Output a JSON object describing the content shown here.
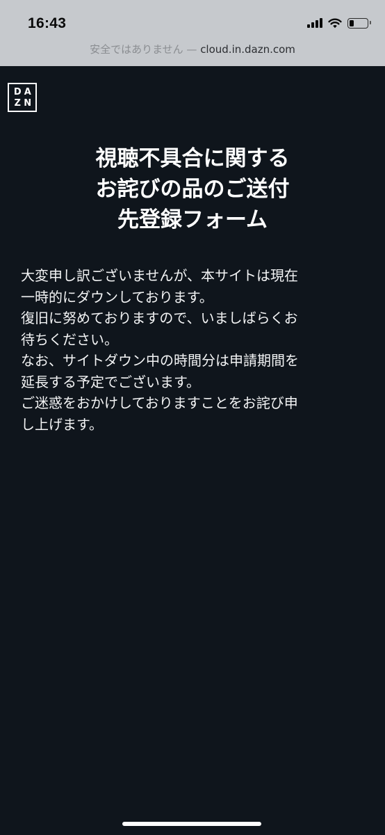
{
  "status_bar": {
    "time": "16:43"
  },
  "browser": {
    "security_warning": "安全ではありません",
    "separator": "—",
    "domain": "cloud.in.dazn.com"
  },
  "logo": {
    "letters": [
      "D",
      "A",
      "Z",
      "N"
    ]
  },
  "title": {
    "lines": [
      "視聴不具合に関する",
      "お詫びの品のご送付",
      "先登録フォーム"
    ]
  },
  "message": {
    "lines": [
      "大変申し訳ございませんが、本サイトは現在",
      "一時的にダウンしております。",
      "復旧に努めておりますので、いましばらくお",
      "待ちください。",
      "なお、サイトダウン中の時間分は申請期間を",
      "延長する予定でございます。",
      "ご迷惑をおかけしておりますことをお詫び申",
      "し上げます。"
    ]
  },
  "colors": {
    "background": "#0f151c",
    "browser_chrome": "#c6c9cd",
    "text": "#ffffff"
  }
}
